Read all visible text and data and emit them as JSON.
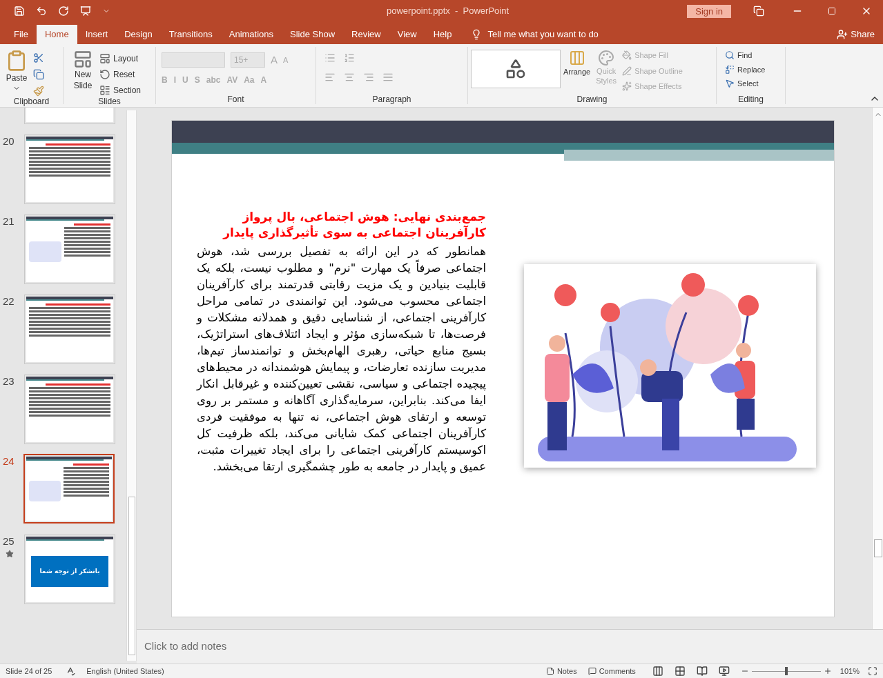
{
  "title_bar": {
    "title": "powerpoint.pptx  -  PowerPoint",
    "sign_in": "Sign in"
  },
  "tabs": [
    {
      "label": "File",
      "selected": false
    },
    {
      "label": "Home",
      "selected": true
    },
    {
      "label": "Insert",
      "selected": false
    },
    {
      "label": "Design",
      "selected": false
    },
    {
      "label": "Transitions",
      "selected": false
    },
    {
      "label": "Animations",
      "selected": false
    },
    {
      "label": "Slide Show",
      "selected": false
    },
    {
      "label": "Review",
      "selected": false
    },
    {
      "label": "View",
      "selected": false
    },
    {
      "label": "Help",
      "selected": false
    }
  ],
  "tell_me": "Tell me what you want to do",
  "share": "Share",
  "ribbon": {
    "clipboard": {
      "label": "Clipboard",
      "paste": "Paste"
    },
    "slides": {
      "label": "Slides",
      "new_slide": "New Slide",
      "items": [
        {
          "kind": "layout",
          "label": "Layout"
        },
        {
          "kind": "reset",
          "label": "Reset"
        },
        {
          "kind": "section",
          "label": "Section"
        }
      ]
    },
    "font": {
      "label": "Font",
      "size": "15+",
      "size_buttons": [
        "A",
        "A"
      ],
      "format_buttons": [
        "B",
        "I",
        "U",
        "S",
        "abc",
        "AV",
        "Aa",
        "A"
      ]
    },
    "paragraph": {
      "label": "Paragraph"
    },
    "drawing": {
      "label": "Drawing",
      "arrange": "Arrange",
      "quick_styles": "Quick Styles",
      "items": [
        {
          "kind": "fill",
          "label": "Shape Fill"
        },
        {
          "kind": "outline",
          "label": "Shape Outline"
        },
        {
          "kind": "effects",
          "label": "Shape Effects"
        }
      ]
    },
    "editing": {
      "label": "Editing",
      "items": [
        {
          "kind": "find",
          "label": "Find"
        },
        {
          "kind": "replace",
          "label": "Replace"
        },
        {
          "kind": "select",
          "label": "Select"
        }
      ]
    }
  },
  "slides": [
    {
      "kind": "text",
      "selected": false
    },
    {
      "number": "20",
      "kind": "text",
      "selected": false
    },
    {
      "number": "21",
      "kind": "text_image",
      "selected": false
    },
    {
      "number": "22",
      "kind": "text",
      "selected": false
    },
    {
      "number": "23",
      "kind": "text",
      "selected": false
    },
    {
      "number": "24",
      "kind": "text_image",
      "selected": true
    },
    {
      "number": "25",
      "kind": "thanks",
      "title": "باتشکر از توجه شما",
      "animated": true,
      "selected": false
    }
  ],
  "slide": {
    "heading": "جمع‌بندی نهایی: هوش اجتماعی، بال پرواز کارآفرینان اجتماعی به سوی تأثیرگذاری پایدار",
    "body": "همانطور که در این ارائه به تفصیل بررسی شد، هوش اجتماعی صرفاً یک مهارت \"نرم\" و مطلوب نیست، بلکه یک قابلیت بنیادین و یک مزیت رقابتی قدرتمند برای کارآفرینان اجتماعی محسوب می‌شود. این توانمندی در تمامی مراحل کارآفرینی اجتماعی، از شناسایی دقیق و همدلانه مشکلات و فرصت‌ها، تا شبکه‌سازی مؤثر و ایجاد ائتلاف‌های استراتژیک، بسیج منابع حیاتی، رهبری الهام‌بخش و توانمندساز تیم‌ها، مدیریت سازنده تعارضات، و پیمایش هوشمندانه در محیط‌های پیچیده اجتماعی و سیاسی، نقشی تعیین‌کننده و غیرقابل انکار ایفا می‌کند. بنابراین، سرمایه‌گذاری آگاهانه و مستمر بر روی توسعه و ارتقای هوش اجتماعی، نه تنها به موفقیت فردی کارآفرینان اجتماعی کمک شایانی می‌کند، بلکه ظرفیت کل اکوسیستم کارآفرینی اجتماعی را برای ایجاد تغییرات مثبت، عمیق و پایدار در جامعه به طور چشمگیری ارتقا می‌بخشد."
  },
  "notes": {
    "placeholder": "Click to add notes"
  },
  "status_bar": {
    "slide_info": "Slide 24 of 25",
    "language": "English (United States)",
    "notes": "Notes",
    "comments": "Comments",
    "zoom": "101%",
    "level": 0.5
  }
}
